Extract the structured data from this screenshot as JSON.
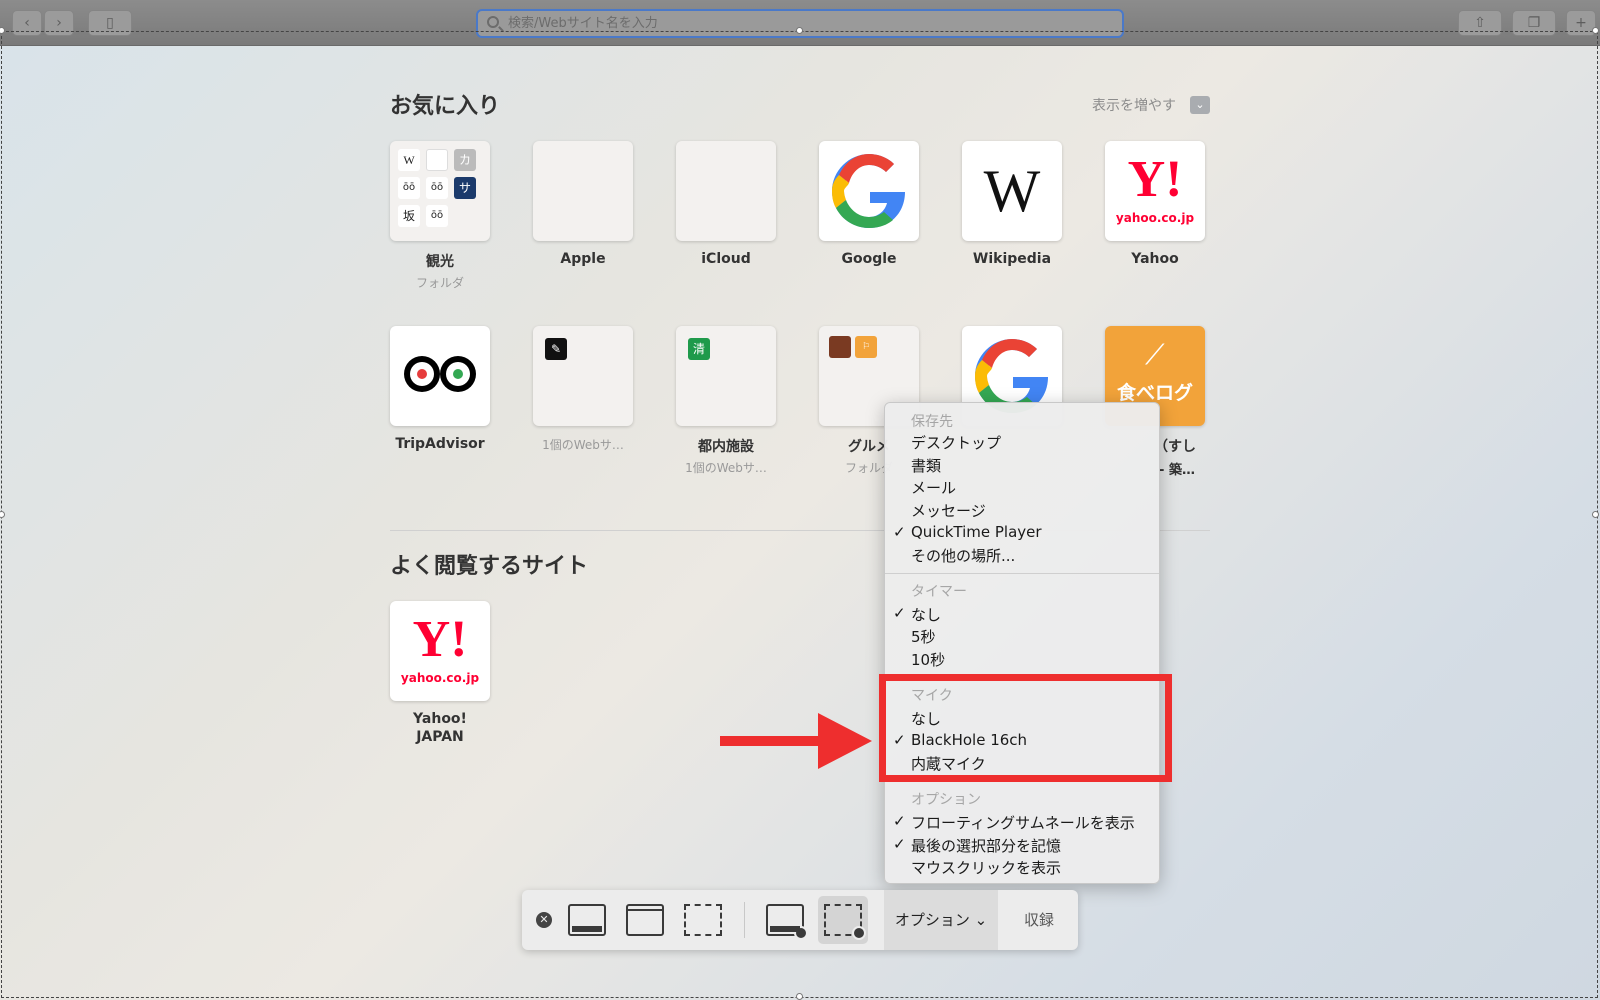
{
  "toolbar": {
    "address_placeholder": "検索/Webサイト名を入力"
  },
  "favorites": {
    "title": "お気に入り",
    "show_more": "表示を増やす",
    "tiles": [
      {
        "label": "観光",
        "sub": "フォルダ"
      },
      {
        "label": "Apple",
        "sub": ""
      },
      {
        "label": "iCloud",
        "sub": ""
      },
      {
        "label": "Google",
        "sub": ""
      },
      {
        "label": "Wikipedia",
        "sub": ""
      },
      {
        "label": "Yahoo",
        "sub": ""
      },
      {
        "label": "TripAdvisor",
        "sub": ""
      },
      {
        "label": "",
        "sub": "1個のWebサ…"
      },
      {
        "label": "都内施設",
        "sub": "1個のWebサ…"
      },
      {
        "label": "グルメ",
        "sub": "フォルダ"
      },
      {
        "label": "",
        "sub": ""
      },
      {
        "label": "（すし",
        "sub": "- 築…"
      }
    ],
    "mini_badges": {
      "kanko_tl": "W",
      "kanko_tr": "カ",
      "kanko_mr": "サ",
      "kanko_bl": "坂",
      "toshisetsu": "清",
      "tabelog_text": "食べログ"
    }
  },
  "frequent": {
    "title": "よく閲覧するサイト",
    "tiles": [
      {
        "label_line1": "Yahoo!",
        "label_line2": "JAPAN"
      }
    ]
  },
  "yahoo_logo": {
    "mark": "Y!",
    "domain": "yahoo.co.jp"
  },
  "menu": {
    "save_header": "保存先",
    "save_items": [
      "デスクトップ",
      "書類",
      "メール",
      "メッセージ",
      "QuickTime Player",
      "その他の場所..."
    ],
    "timer_header": "タイマー",
    "timer_items": [
      "なし",
      "5秒",
      "10秒"
    ],
    "mic_header": "マイク",
    "mic_items": [
      "なし",
      "BlackHole 16ch",
      "内蔵マイク"
    ],
    "option_header": "オプション",
    "option_items": [
      "フローティングサムネールを表示",
      "最後の選択部分を記憶",
      "マウスクリックを表示"
    ],
    "check": "✓"
  },
  "capture_bar": {
    "options_label": "オプション",
    "record_label": "収録"
  },
  "colors": {
    "annotation_red": "#ee2e2e",
    "address_focus": "#4a79c9"
  }
}
